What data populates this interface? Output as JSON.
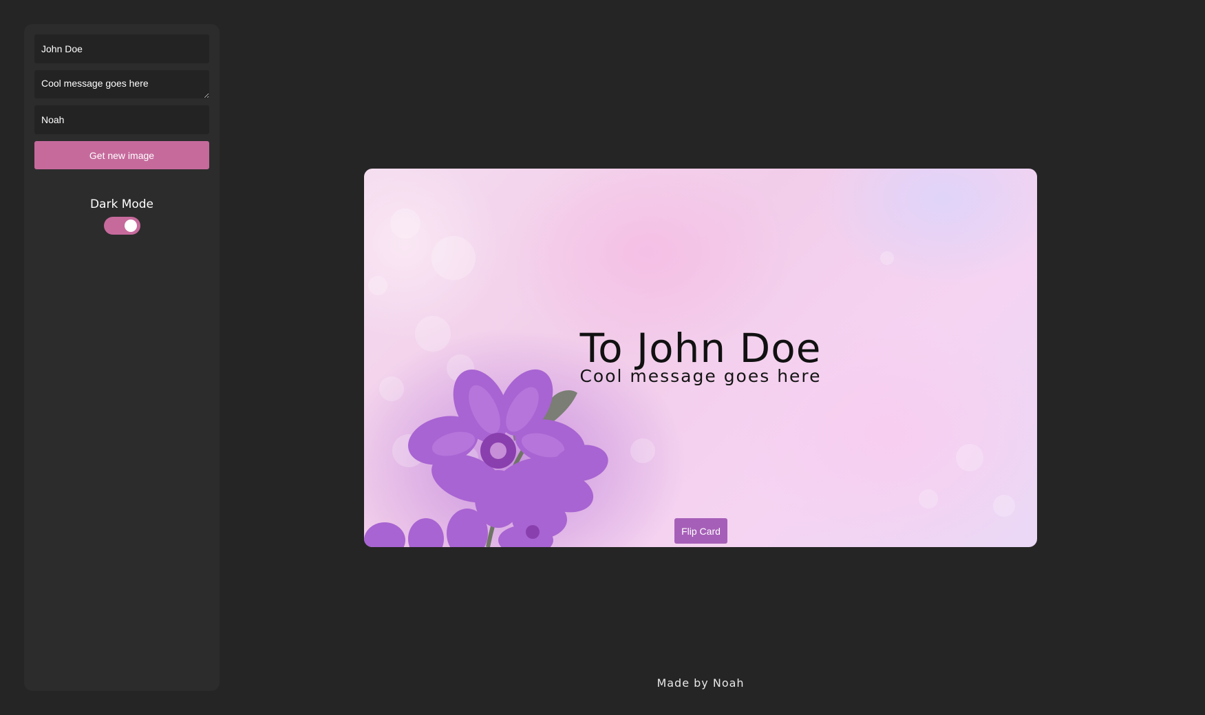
{
  "form": {
    "recipient_value": "John Doe",
    "message_value": "Cool message goes here",
    "sender_value": "Noah",
    "new_image_label": "Get new image"
  },
  "theme_toggle": {
    "label": "Dark Mode",
    "checked": true
  },
  "card": {
    "to_line": "To John Doe",
    "message": "Cool message goes here",
    "flip_label": "Flip Card",
    "image_subject": "purple flower on pink bokeh background"
  },
  "footer": {
    "credit": "Made by Noah"
  },
  "colors": {
    "background": "#252525",
    "sidebar": "#2c2c2c",
    "input": "#232323",
    "accent_pink": "#c66a9c",
    "flip_button": "#a65fb8"
  }
}
